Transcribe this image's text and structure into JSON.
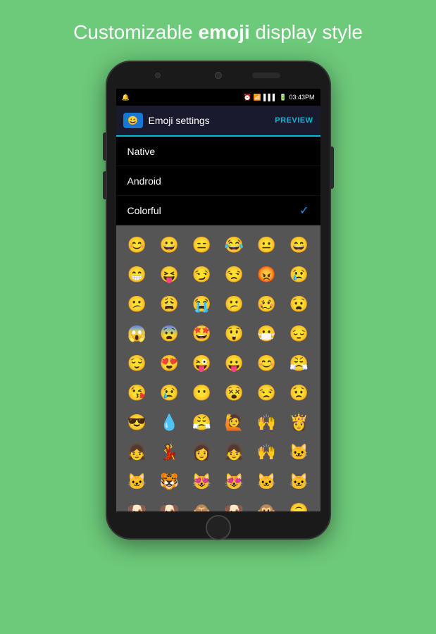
{
  "page": {
    "background_color": "#6dca7a",
    "header": {
      "text_part1": "Customizable ",
      "text_bold": "emoji",
      "text_part2": " display style"
    }
  },
  "status_bar": {
    "left_icon": "🔔",
    "time": "03:43PM",
    "icons": "⏰ 📶 🔋"
  },
  "app_bar": {
    "icon_emoji": "😀",
    "title": "Emoji settings",
    "preview_label": "PREVIEW"
  },
  "menu": {
    "items": [
      {
        "label": "Native",
        "checked": false
      },
      {
        "label": "Android",
        "checked": false
      },
      {
        "label": "Colorful",
        "checked": true
      }
    ]
  },
  "emoji_grid": {
    "emojis": [
      "😊",
      "😀",
      "😑",
      "😂",
      "😐",
      "😄",
      "😁",
      "😝",
      "😏",
      "😒",
      "😡",
      "😢",
      "😕",
      "😩",
      "😭",
      "😕",
      "🥴",
      "😧",
      "😱",
      "😨",
      "🤩",
      "😲",
      "😷",
      "😔",
      "😌",
      "😍",
      "😜",
      "😛",
      "😊",
      "😤",
      "😘",
      "😢",
      "😶",
      "😵",
      "😒",
      "😟",
      "😎",
      "💧",
      "😤",
      "🙋",
      "🙌",
      "👸",
      "👧",
      "💃",
      "👩",
      "👧",
      "🙌",
      "🐱",
      "🐱",
      "🐯",
      "😻",
      "😻",
      "🐱",
      "🐱",
      "🐶",
      "🐶",
      "🙈",
      "🐶",
      "🐵",
      "🙃"
    ]
  }
}
